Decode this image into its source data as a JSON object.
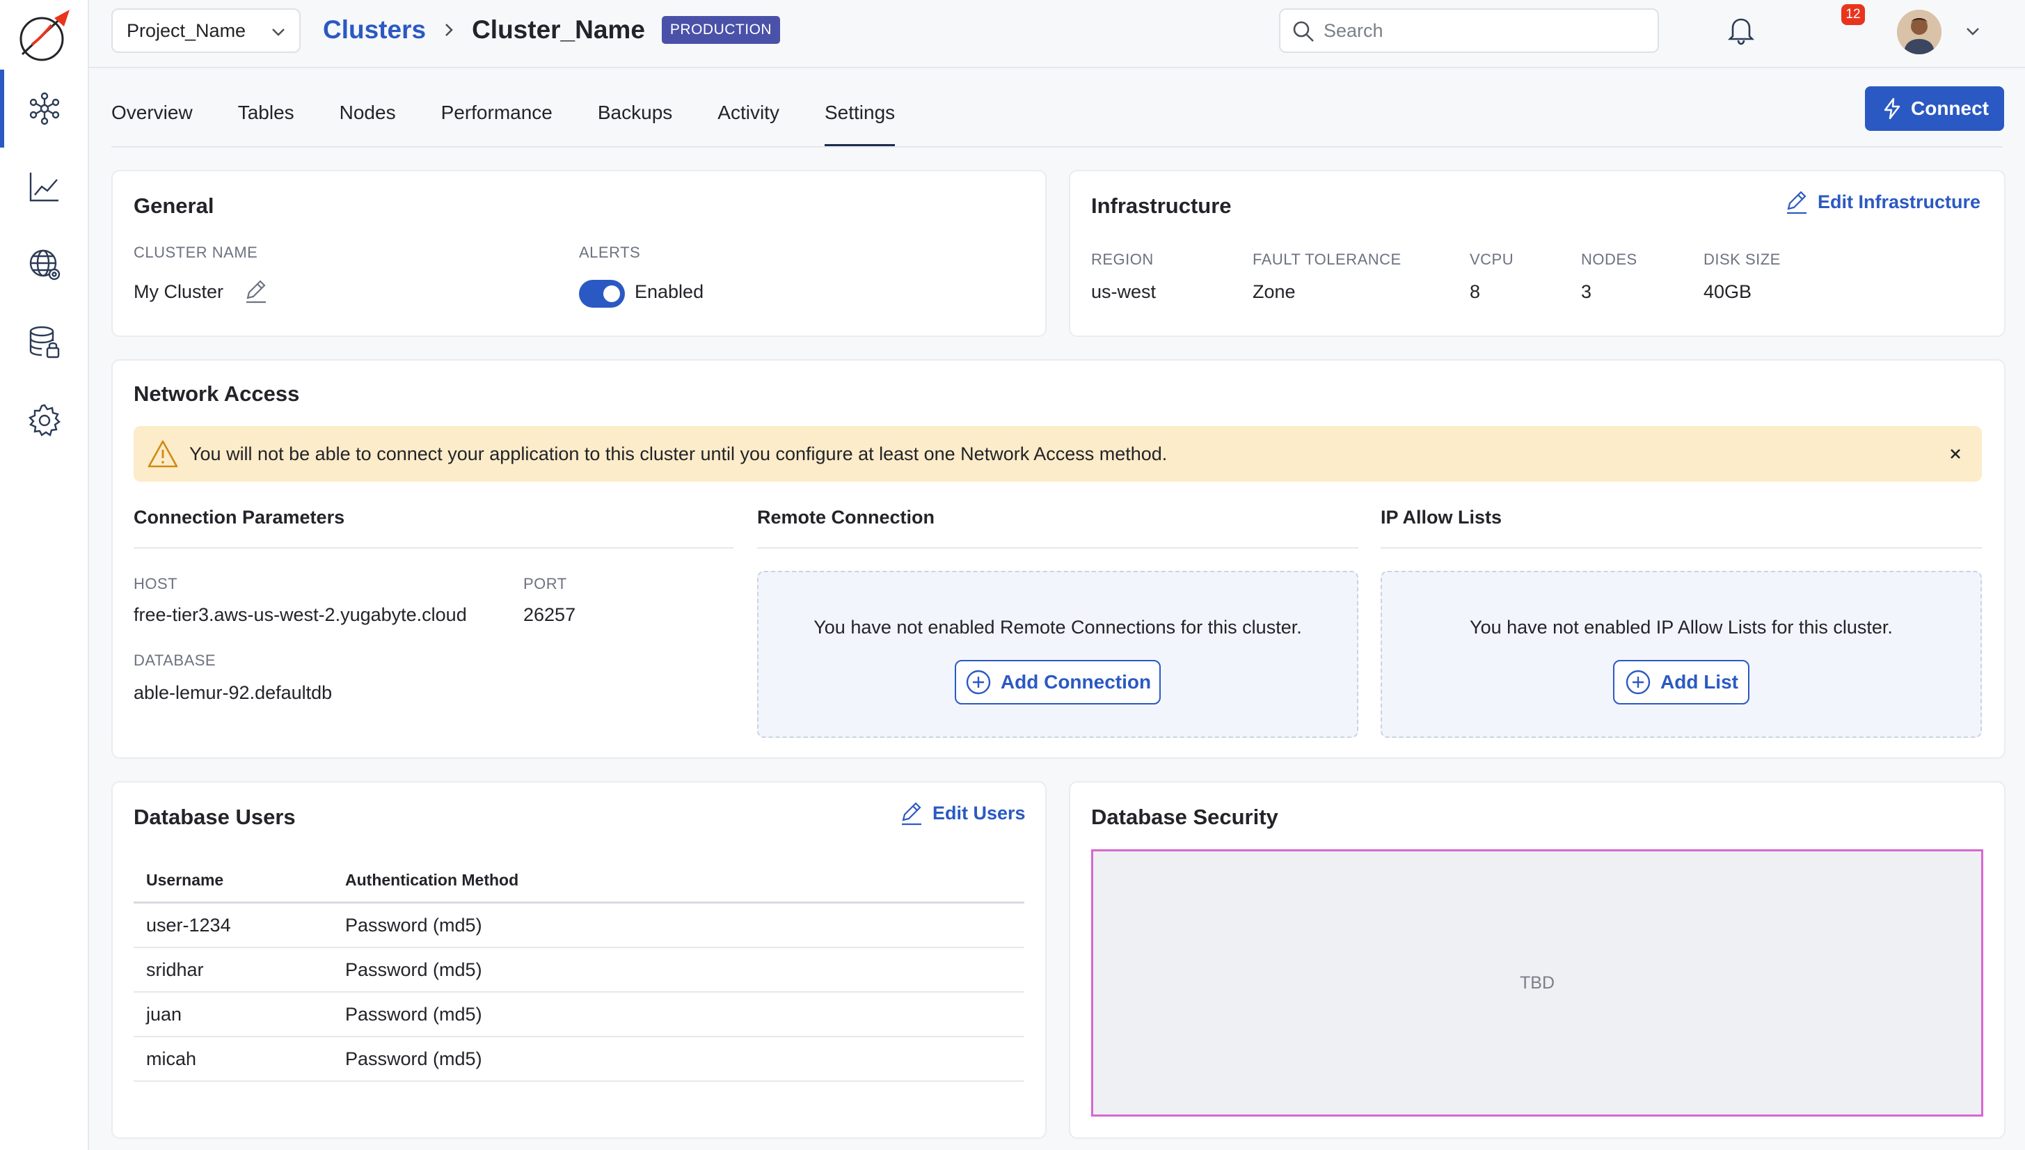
{
  "topbar": {
    "project": "Project_Name",
    "breadcrumb_parent": "Clusters",
    "breadcrumb_current": "Cluster_Name",
    "environment_badge": "PRODUCTION",
    "search_placeholder": "Search",
    "notification_count": "12"
  },
  "tabs": [
    {
      "label": "Overview",
      "active": false
    },
    {
      "label": "Tables",
      "active": false
    },
    {
      "label": "Nodes",
      "active": false
    },
    {
      "label": "Performance",
      "active": false
    },
    {
      "label": "Backups",
      "active": false
    },
    {
      "label": "Activity",
      "active": false
    },
    {
      "label": "Settings",
      "active": true
    }
  ],
  "connect_label": "Connect",
  "general": {
    "title": "General",
    "cluster_name_label": "CLUSTER NAME",
    "cluster_name": "My Cluster",
    "alerts_label": "ALERTS",
    "alerts_value": "Enabled",
    "alerts_enabled": true
  },
  "infrastructure": {
    "title": "Infrastructure",
    "edit_label": "Edit Infrastructure",
    "fields": [
      {
        "label": "REGION",
        "value": "us-west"
      },
      {
        "label": "FAULT TOLERANCE",
        "value": "Zone"
      },
      {
        "label": "VCPU",
        "value": "8"
      },
      {
        "label": "NODES",
        "value": "3"
      },
      {
        "label": "DISK SIZE",
        "value": "40GB"
      }
    ]
  },
  "network": {
    "title": "Network Access",
    "warning": "You will not be able to connect your application to this cluster until you configure at least one Network Access method.",
    "connection_parameters": {
      "title": "Connection Parameters",
      "host_label": "HOST",
      "host": "free-tier3.aws-us-west-2.yugabyte.cloud",
      "port_label": "PORT",
      "port": "26257",
      "database_label": "DATABASE",
      "database": "able-lemur-92.defaultdb"
    },
    "remote_connection": {
      "title": "Remote Connection",
      "empty_text": "You have not enabled Remote Connections for this cluster.",
      "button": "Add Connection"
    },
    "ip_allow_lists": {
      "title": "IP Allow Lists",
      "empty_text": "You have not enabled IP Allow Lists for this cluster.",
      "button": "Add List"
    }
  },
  "database_users": {
    "title": "Database Users",
    "edit_label": "Edit Users",
    "columns": [
      "Username",
      "Authentication Method"
    ],
    "rows": [
      {
        "username": "user-1234",
        "method": "Password (md5)"
      },
      {
        "username": "sridhar",
        "method": "Password (md5)"
      },
      {
        "username": "juan",
        "method": "Password (md5)"
      },
      {
        "username": "micah",
        "method": "Password (md5)"
      }
    ]
  },
  "database_security": {
    "title": "Database Security",
    "placeholder": "TBD"
  },
  "colors": {
    "accent": "#2b59c3",
    "badge": "#4a51a8",
    "warning_bg": "#fcecc9",
    "notification": "#e8351e"
  },
  "icons": [
    "app-logo-icon",
    "cluster-icon",
    "chart-icon",
    "globe-gear-icon",
    "database-lock-icon",
    "gear-icon",
    "search-icon",
    "bell-icon",
    "chevron-down-icon",
    "lightning-icon",
    "pencil-icon",
    "warning-icon",
    "close-icon",
    "plus-circle-icon"
  ]
}
